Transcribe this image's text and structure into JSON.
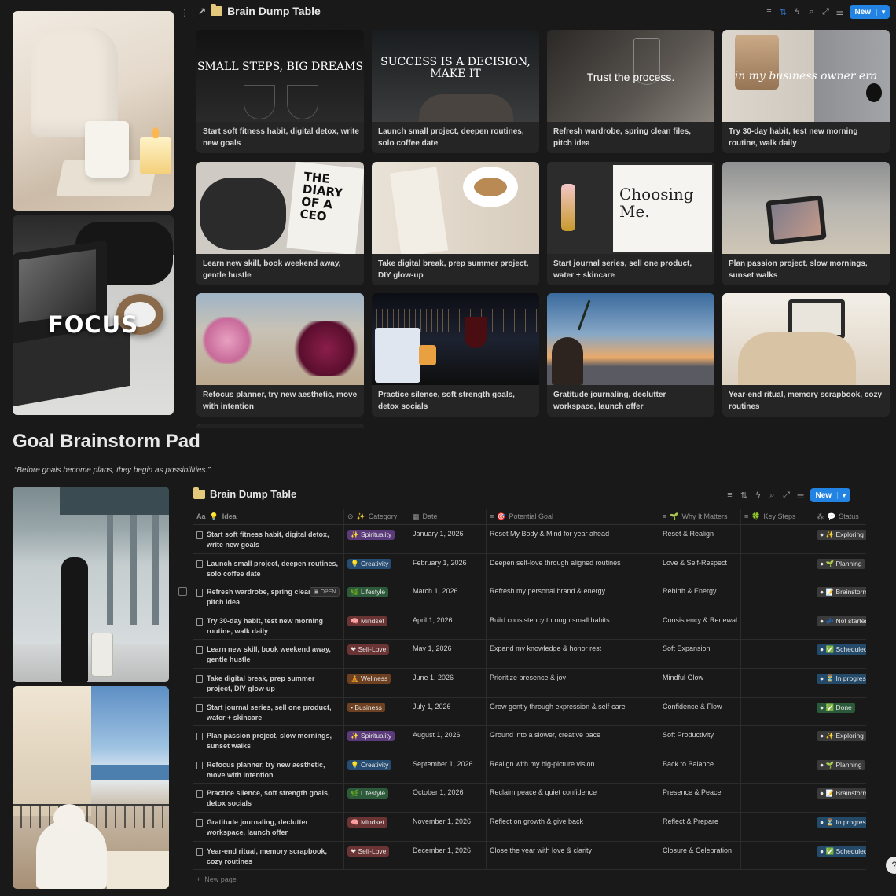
{
  "gallery": {
    "title": "Brain Dump Table",
    "new_label": "New",
    "cards": [
      {
        "quote": "SMALL STEPS, BIG DREAMS",
        "caption": "Start soft fitness habit, digital detox, write new goals"
      },
      {
        "quote": "SUCCESS IS A DECISION, MAKE IT",
        "caption": "Launch small project, deepen routines, solo coffee date"
      },
      {
        "quote": "Trust the process.",
        "caption": "Refresh wardrobe, spring clean files, pitch idea"
      },
      {
        "quote": "in my business owner era",
        "caption": "Try 30-day habit, test new morning routine, walk daily"
      },
      {
        "quote": "THE DIARY OF A CEO",
        "caption": "Learn new skill, book weekend away, gentle hustle"
      },
      {
        "quote": "",
        "caption": "Take digital break, prep summer project, DIY glow-up"
      },
      {
        "quote": "Choosing Me.",
        "caption": "Start journal series, sell one product, water + skincare"
      },
      {
        "quote": "",
        "caption": "Plan passion project, slow mornings, sunset walks"
      },
      {
        "quote": "",
        "caption": "Refocus planner, try new aesthetic, move with intention"
      },
      {
        "quote": "",
        "caption": "Practice silence, soft strength goals, detox socials"
      },
      {
        "quote": "",
        "caption": "Gratitude journaling, declutter workspace, launch offer"
      },
      {
        "quote": "",
        "caption": "Year-end ritual, memory scrapbook, cozy routines"
      }
    ]
  },
  "left_photos": {
    "focus_text": "FOCUS"
  },
  "section": {
    "title": "Goal Brainstorm Pad",
    "quote": "“Before goals become plans, they begin as possibilities.”"
  },
  "table": {
    "title": "Brain Dump Table",
    "new_label": "New",
    "open_label": "OPEN",
    "new_page_label": "New page",
    "columns": {
      "idea": "Idea",
      "category": "Category",
      "date": "Date",
      "goal": "Potential Goal",
      "why": "Why It Matters",
      "steps": "Key Steps",
      "status": "Status"
    },
    "rows": [
      {
        "idea": "Start soft fitness habit, digital detox, write new goals",
        "category": "Spirituality",
        "cat_color": "#5a3a7a",
        "cat_icon": "✨",
        "date": "January 1, 2026",
        "goal": "Reset My Body & Mind for year ahead",
        "why": "Reset & Realign",
        "status": "Exploring",
        "st_color": "#3a3a3a",
        "st_icon": "✨"
      },
      {
        "idea": "Launch small project, deepen routines, solo coffee date",
        "category": "Creativity",
        "cat_color": "#274c72",
        "cat_icon": "💡",
        "date": "February 1, 2026",
        "goal": "Deepen self-love through aligned routines",
        "why": "Love & Self-Respect",
        "status": "Planning",
        "st_color": "#3a3a3a",
        "st_icon": "🌱"
      },
      {
        "idea": "Refresh wardrobe, spring clean files, pitch idea",
        "category": "Lifestyle",
        "cat_color": "#2d5a3a",
        "cat_icon": "🌿",
        "date": "March 1, 2026",
        "goal": "Refresh my personal brand & energy",
        "why": "Rebirth & Energy",
        "status": "Brainstorm",
        "st_color": "#3a3a3a",
        "st_icon": "📝"
      },
      {
        "idea": "Try 30-day habit, test new morning routine, walk daily",
        "category": "Mindset",
        "cat_color": "#6a3434",
        "cat_icon": "🧠",
        "date": "April 1, 2026",
        "goal": "Build consistency through small habits",
        "why": "Consistency & Renewal",
        "status": "Not started",
        "st_color": "#3a3a3a",
        "st_icon": "💤"
      },
      {
        "idea": "Learn new skill, book weekend away, gentle hustle",
        "category": "Self-Love",
        "cat_color": "#6a3434",
        "cat_icon": "❤",
        "date": "May 1, 2026",
        "goal": "Expand my knowledge & honor rest",
        "why": "Soft Expansion",
        "status": "Scheduled",
        "st_color": "#244a6a",
        "st_icon": "✅"
      },
      {
        "idea": "Take digital break, prep summer project, DIY glow-up",
        "category": "Wellness",
        "cat_color": "#6e4022",
        "cat_icon": "🧘",
        "date": "June 1, 2026",
        "goal": "Prioritize presence & joy",
        "why": "Mindful Glow",
        "status": "In progress",
        "st_color": "#244a6a",
        "st_icon": "⏳"
      },
      {
        "idea": "Start journal series, sell one product, water + skincare",
        "category": "Business",
        "cat_color": "#6e4022",
        "cat_icon": "•",
        "date": "July 1, 2026",
        "goal": "Grow gently through expression & self-care",
        "why": "Confidence & Flow",
        "status": "Done",
        "st_color": "#2b5a3a",
        "st_icon": "✅"
      },
      {
        "idea": "Plan passion project, slow mornings, sunset walks",
        "category": "Spirituality",
        "cat_color": "#5a3a7a",
        "cat_icon": "✨",
        "date": "August 1, 2026",
        "goal": "Ground into a slower, creative pace",
        "why": "Soft Productivity",
        "status": "Exploring",
        "st_color": "#3a3a3a",
        "st_icon": "✨"
      },
      {
        "idea": "Refocus planner, try new aesthetic, move with intention",
        "category": "Creativity",
        "cat_color": "#274c72",
        "cat_icon": "💡",
        "date": "September 1, 2026",
        "goal": "Realign with my big-picture vision",
        "why": "Back to Balance",
        "status": "Planning",
        "st_color": "#3a3a3a",
        "st_icon": "🌱"
      },
      {
        "idea": "Practice silence, soft strength goals, detox socials",
        "category": "Lifestyle",
        "cat_color": "#2d5a3a",
        "cat_icon": "🌿",
        "date": "October 1, 2026",
        "goal": "Reclaim peace & quiet confidence",
        "why": "Presence & Peace",
        "status": "Brainstorm",
        "st_color": "#3a3a3a",
        "st_icon": "📝"
      },
      {
        "idea": "Gratitude journaling, declutter workspace, launch offer",
        "category": "Mindset",
        "cat_color": "#6a3434",
        "cat_icon": "🧠",
        "date": "November 1, 2026",
        "goal": "Reflect on growth & give back",
        "why": "Reflect & Prepare",
        "status": "In progress",
        "st_color": "#244a6a",
        "st_icon": "⏳"
      },
      {
        "idea": "Year-end ritual, memory scrapbook, cozy routines",
        "category": "Self-Love",
        "cat_color": "#6a3434",
        "cat_icon": "❤",
        "date": "December 1, 2026",
        "goal": "Close the year with love & clarity",
        "why": "Closure & Celebration",
        "status": "Scheduled",
        "st_color": "#244a6a",
        "st_icon": "✅"
      }
    ]
  }
}
